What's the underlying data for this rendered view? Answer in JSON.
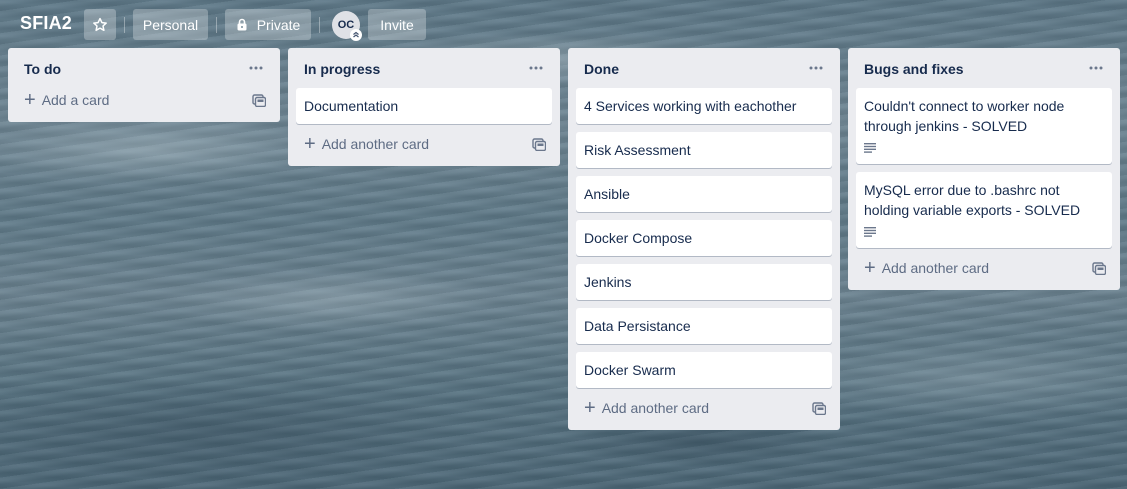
{
  "board": {
    "title": "SFIA2",
    "visibility_team_label": "Personal",
    "privacy_label": "Private",
    "avatar_initials": "OC",
    "invite_label": "Invite"
  },
  "lists": [
    {
      "title": "To do",
      "cards": [],
      "add_label": "Add a card"
    },
    {
      "title": "In progress",
      "cards": [
        {
          "text": "Documentation"
        }
      ],
      "add_label": "Add another card"
    },
    {
      "title": "Done",
      "cards": [
        {
          "text": "4 Services working with eachother"
        },
        {
          "text": "Risk Assessment"
        },
        {
          "text": "Ansible"
        },
        {
          "text": "Docker Compose"
        },
        {
          "text": "Jenkins"
        },
        {
          "text": "Data Persistance"
        },
        {
          "text": "Docker Swarm"
        }
      ],
      "add_label": "Add another card"
    },
    {
      "title": "Bugs and fixes",
      "cards": [
        {
          "text": "Couldn't connect to worker node through jenkins - SOLVED"
        },
        {
          "text": "MySQL error due to .bashrc not holding variable exports - SOLVED"
        }
      ],
      "add_label": "Add another card"
    }
  ],
  "icons": {
    "star": "star-icon",
    "lock": "lock-icon",
    "menu": "ellipsis-icon",
    "plus": "plus-icon",
    "template": "card-template-icon",
    "description": "description-icon"
  }
}
